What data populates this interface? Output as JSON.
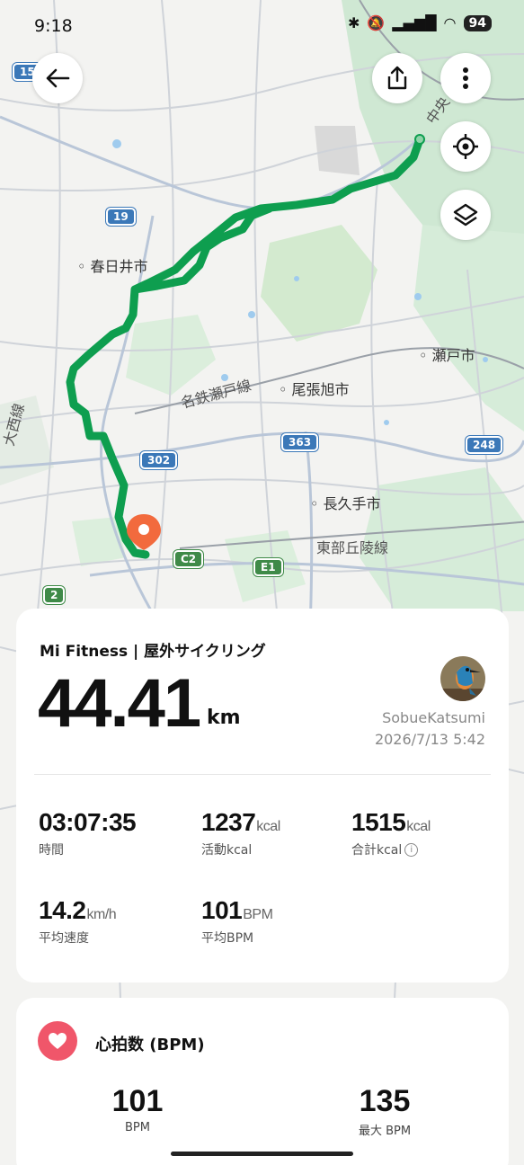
{
  "status_bar": {
    "time": "9:18",
    "battery": "94"
  },
  "map": {
    "labels": {
      "kasugai": "春日井市",
      "owariasahi": "尾張旭市",
      "seto": "瀬戸市",
      "nagakute": "長久手市",
      "meitetsu_seto_line": "名鉄瀬戸線",
      "tobu_kyuryo_line": "東部丘陵線",
      "chuo": "中央",
      "nishi_line": "大西線"
    },
    "shields": {
      "r19": "19",
      "r15": "15",
      "r363": "363",
      "r302": "302",
      "r248": "248",
      "c2": "C2",
      "e1": "E1",
      "r2": "2"
    },
    "route_color": "#0e9e4f",
    "pin_color": "#f26a3d"
  },
  "summary": {
    "app_title": "Mi Fitness | 屋外サイクリング",
    "distance": "44.41",
    "distance_unit": "km",
    "user_name": "SobueKatsumi",
    "datetime": "2026/7/13 5:42",
    "stats": [
      {
        "value": "03:07:35",
        "unit": "",
        "label": "時間"
      },
      {
        "value": "1237",
        "unit": "kcal",
        "label": "活動kcal"
      },
      {
        "value": "1515",
        "unit": "kcal",
        "label": "合計kcal"
      },
      {
        "value": "14.2",
        "unit": "km/h",
        "label": "平均速度"
      },
      {
        "value": "101",
        "unit": "BPM",
        "label": "平均BPM"
      }
    ]
  },
  "heart_rate": {
    "title": "心拍数 (BPM)",
    "avg_value": "101",
    "avg_label": "BPM",
    "max_value": "135",
    "max_label": "最大 BPM",
    "accent_color": "#f0566a"
  }
}
